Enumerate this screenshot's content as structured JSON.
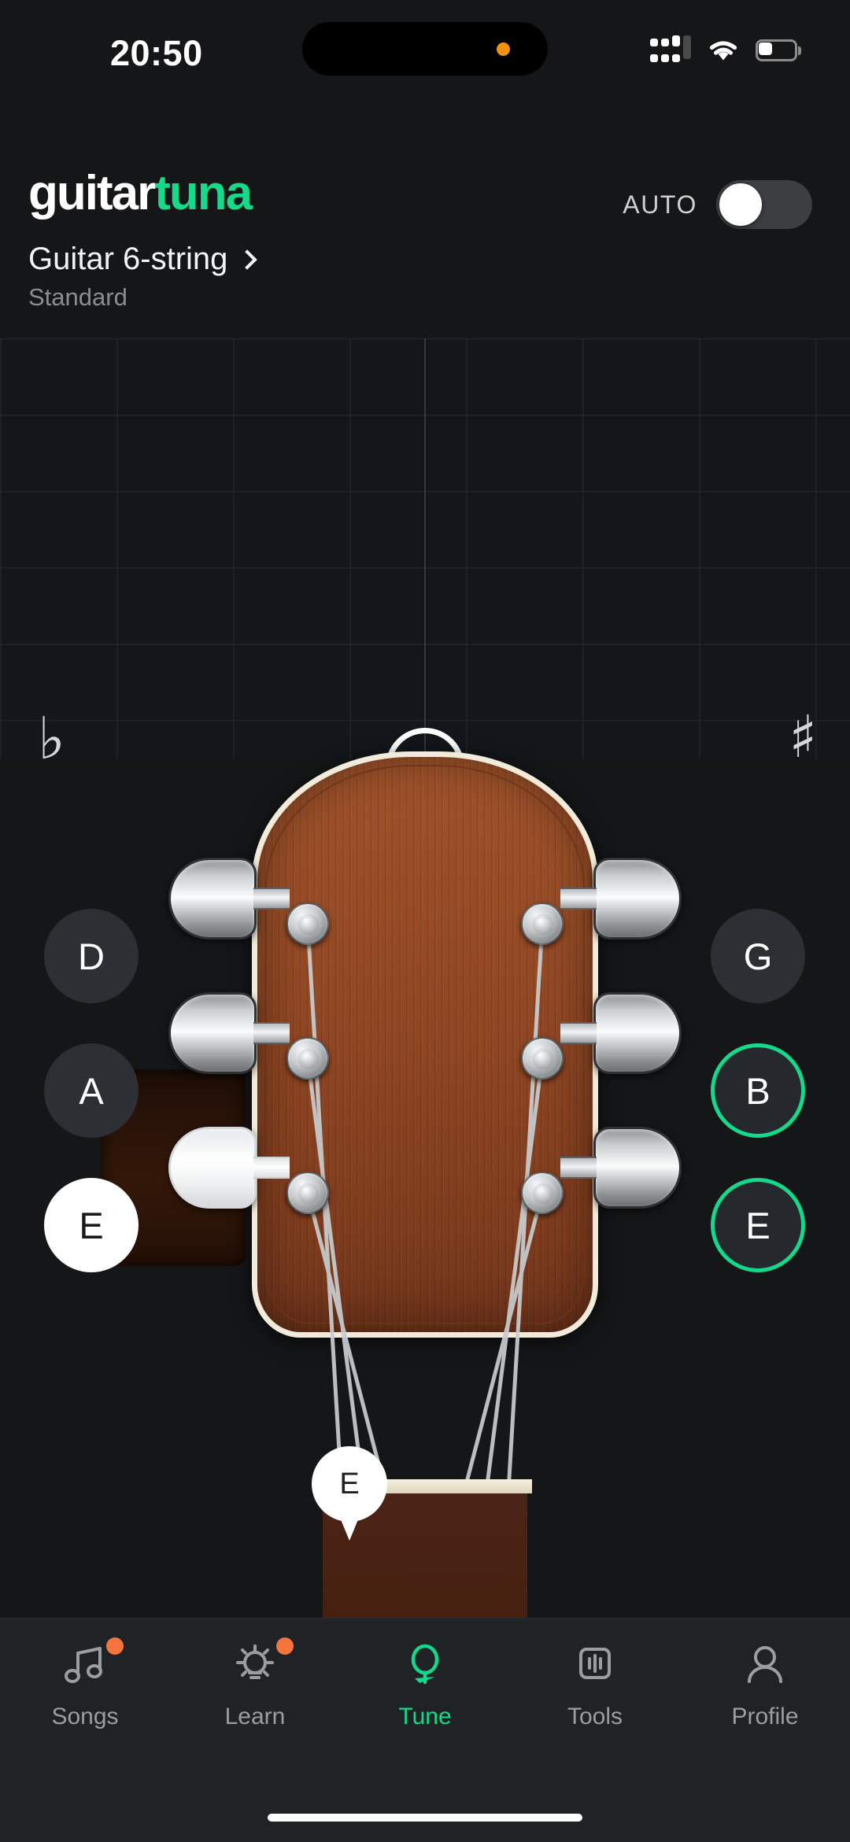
{
  "status_bar": {
    "time": "20:50",
    "recording_dot": "orange-dot-icon",
    "cellular": "cellular-signal-icon",
    "wifi": "wifi-icon",
    "battery": "battery-icon",
    "battery_level_pct": 30
  },
  "header": {
    "logo_part1": "guitar",
    "logo_part2": "tuna",
    "auto_label": "AUTO",
    "auto_enabled": false,
    "instrument": "Guitar 6-string",
    "tuning_preset": "Standard",
    "chevron": "chevron-right-icon"
  },
  "meter": {
    "flat_symbol": "♭",
    "sharp_symbol": "♯",
    "indicator": "tuning-needle-ring",
    "trace_color": "#CE9A4A"
  },
  "strings": {
    "left": [
      {
        "note": "D",
        "state": "idle"
      },
      {
        "note": "A",
        "state": "idle"
      },
      {
        "note": "E",
        "state": "active"
      }
    ],
    "right": [
      {
        "note": "G",
        "state": "idle"
      },
      {
        "note": "B",
        "state": "tuned"
      },
      {
        "note": "E",
        "state": "tuned"
      }
    ]
  },
  "nut_badge": {
    "note": "E"
  },
  "tabbar": {
    "items": [
      {
        "label": "Songs",
        "icon": "music-note-icon",
        "active": false,
        "badge": true
      },
      {
        "label": "Learn",
        "icon": "lightbulb-icon",
        "active": false,
        "badge": true
      },
      {
        "label": "Tune",
        "icon": "tuning-fork-icon",
        "active": true,
        "badge": false
      },
      {
        "label": "Tools",
        "icon": "equalizer-icon",
        "active": false,
        "badge": false
      },
      {
        "label": "Profile",
        "icon": "person-icon",
        "active": false,
        "badge": false
      }
    ]
  },
  "colors": {
    "accent_green": "#14D88A",
    "badge_orange": "#F4743B",
    "background": "#151617"
  }
}
